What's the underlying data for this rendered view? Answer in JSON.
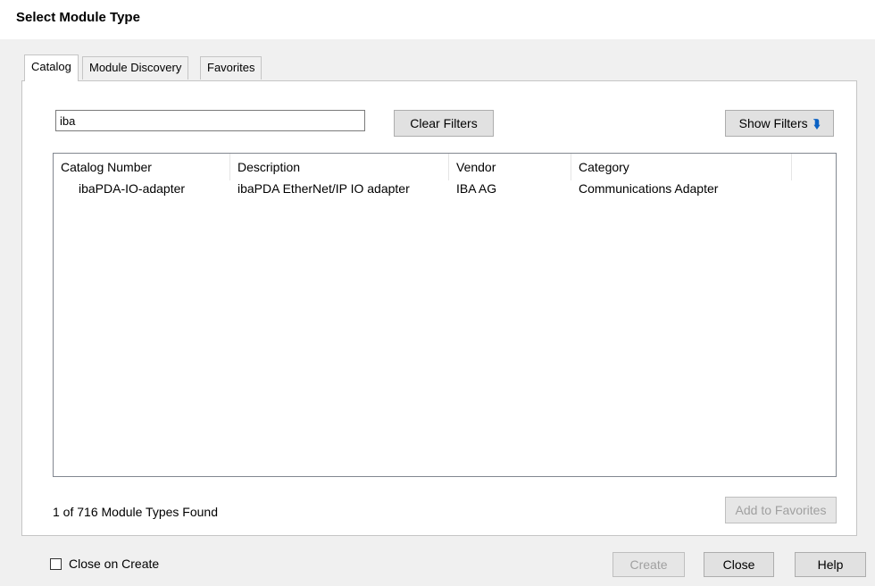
{
  "dialog": {
    "title": "Select Module Type"
  },
  "tabs": [
    {
      "label": "Catalog",
      "active": true
    },
    {
      "label": "Module Discovery",
      "active": false
    },
    {
      "label": "Favorites",
      "active": false
    }
  ],
  "filters": {
    "search_value": "iba",
    "clear_label": "Clear Filters",
    "show_label": "Show Filters",
    "show_icon": "double-chevron-down-icon"
  },
  "table": {
    "columns": [
      "Catalog Number",
      "Description",
      "Vendor",
      "Category"
    ],
    "rows": [
      [
        "ibaPDA-IO-adapter",
        "ibaPDA EtherNet/IP IO adapter",
        "IBA AG",
        "Communications Adapter"
      ]
    ]
  },
  "status_text": "1 of 716 Module Types Found",
  "add_favorites_label": "Add to Favorites",
  "close_on_create": {
    "label": "Close on Create",
    "checked": false
  },
  "footer": {
    "create_label": "Create",
    "close_label": "Close",
    "help_label": "Help"
  },
  "colors": {
    "accent": "#0078d7",
    "dialog_bg": "#f0f0f0",
    "disabled_text": "#a0a0a0"
  }
}
